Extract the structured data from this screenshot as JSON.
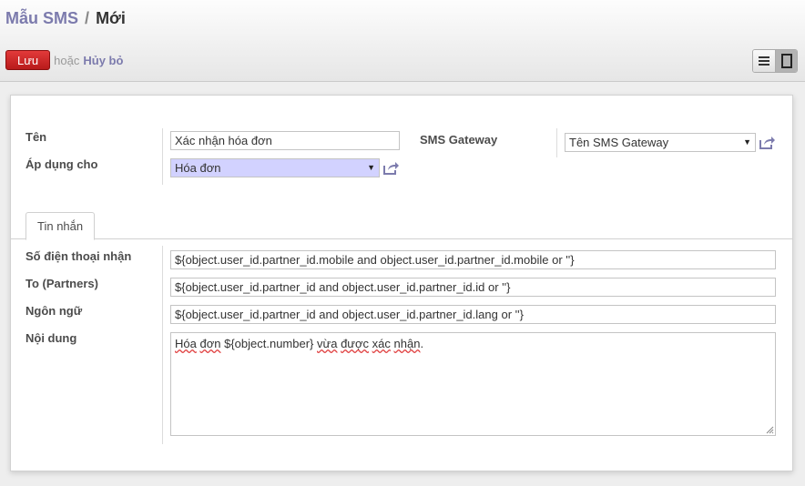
{
  "breadcrumb": {
    "parent": "Mẫu SMS",
    "separator": "/",
    "current": "Mới"
  },
  "actions": {
    "save_label": "Lưu",
    "or_text": "hoặc",
    "discard_label": "Hủy bỏ"
  },
  "view_switch": [
    "list-view",
    "form-view"
  ],
  "form": {
    "name_label": "Tên",
    "name_value": "Xác nhận hóa đơn",
    "apply_label": "Áp dụng cho",
    "apply_value": "Hóa đơn",
    "gateway_label": "SMS Gateway",
    "gateway_value": "Tên SMS Gateway"
  },
  "tabs": [
    {
      "label": "Tin nhắn"
    }
  ],
  "message": {
    "phone_label": "Số điện thoại nhận",
    "phone_value": "${object.user_id.partner_id.mobile and object.user_id.partner_id.mobile or ''}",
    "partners_label": "To (Partners)",
    "partners_value": "${object.user_id.partner_id and object.user_id.partner_id.id or ''}",
    "lang_label": "Ngôn ngữ",
    "lang_value": "${object.user_id.partner_id and object.user_id.partner_id.lang or ''}",
    "content_label": "Nội dung",
    "content_words": [
      "Hóa",
      " ",
      "đơn",
      " ${object.number} ",
      "vừa",
      " ",
      "được",
      " ",
      "xác",
      " ",
      "nhận",
      "."
    ]
  },
  "colors": {
    "link": "#7c7bad",
    "save": "#c72424",
    "required_bg": "#d2d2ff"
  }
}
